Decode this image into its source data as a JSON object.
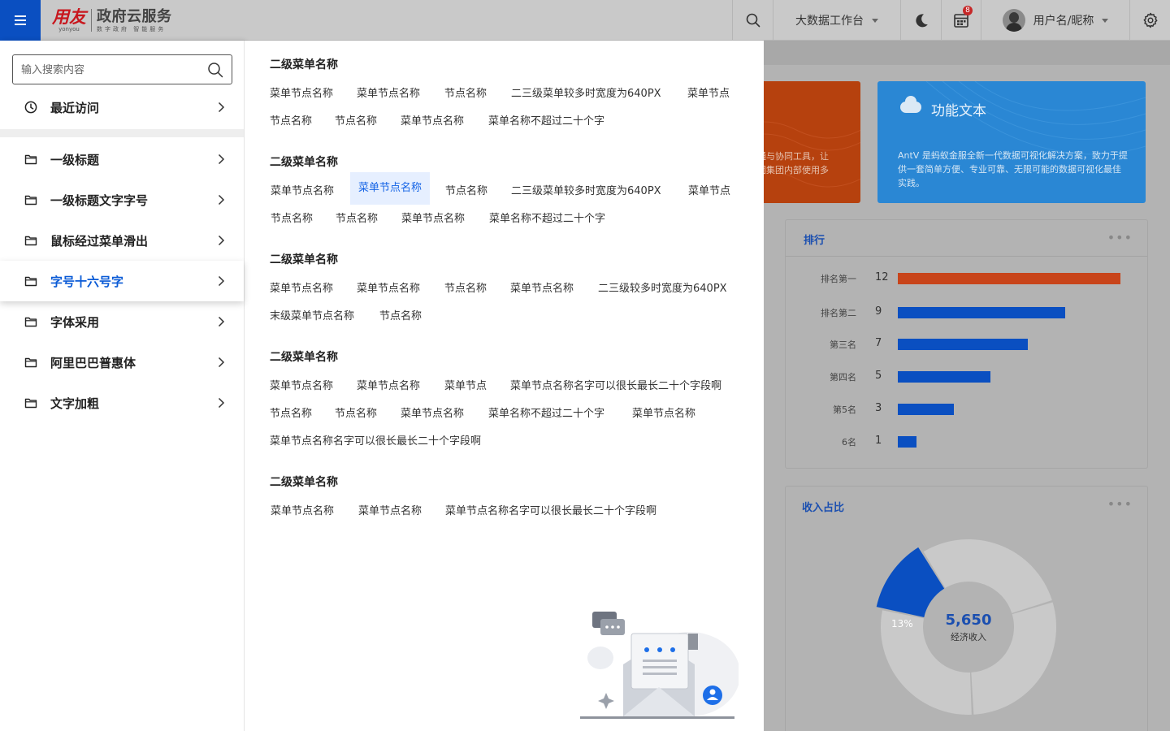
{
  "header": {
    "menu_icon": "hamburger-icon",
    "logo": {
      "brand": "用友",
      "brand_sub": "yonyou",
      "product": "政府云服务",
      "slogan": "数字政府 智能服务"
    },
    "workbench_label": "大数据工作台",
    "notification_count": "8",
    "username": "用户名/昵称",
    "icons": {
      "search": "search-icon",
      "theme": "moon-icon",
      "notice": "calendar-icon",
      "settings": "gear-icon"
    }
  },
  "sidebar": {
    "search_placeholder": "输入搜索内容",
    "recent_label": "最近访问",
    "items": [
      {
        "label": "一级标题"
      },
      {
        "label": "一级标题文字字号"
      },
      {
        "label": "鼠标经过菜单滑出"
      },
      {
        "label": "字号十六号字",
        "active": true
      },
      {
        "label": "字体采用"
      },
      {
        "label": "阿里巴巴普惠体"
      },
      {
        "label": "文字加粗"
      }
    ]
  },
  "flyout": {
    "groups": [
      {
        "title": "二级菜单名称",
        "rows": [
          [
            "菜单节点名称",
            "菜单节点名称",
            "节点名称",
            "二三级菜单较多时宽度为640PX",
            "菜单节点"
          ],
          [
            "节点名称",
            "节点名称",
            "菜单节点名称",
            "菜单名称不超过二十个字"
          ]
        ]
      },
      {
        "title": "二级菜单名称",
        "rows": [
          [
            "菜单节点名称",
            "菜单节点名称",
            "节点名称",
            "二三级菜单较多时宽度为640PX",
            "菜单节点"
          ],
          [
            "节点名称",
            "节点名称",
            "菜单节点名称",
            "菜单名称不超过二十个字"
          ]
        ]
      },
      {
        "title": "二级菜单名称",
        "rows": [
          [
            "菜单节点名称",
            "菜单节点名称",
            "节点名称",
            "菜单节点名称",
            "二三级较多时宽度为640PX"
          ],
          [
            "末级菜单节点名称",
            "节点名称"
          ]
        ]
      },
      {
        "title": "二级菜单名称",
        "rows": [
          [
            "菜单节点名称",
            "菜单节点名称",
            "菜单节点",
            "菜单节点名称名字可以很长最长二十个字段啊"
          ],
          [
            "节点名称",
            "节点名称",
            "菜单节点名称",
            "菜单名称不超过二十个字",
            "菜单节点名称"
          ],
          [
            "菜单节点名称名字可以很长最长二十个字段啊"
          ]
        ]
      },
      {
        "title": "二级菜单名称",
        "rows": [
          [
            "菜单节点名称",
            "菜单节点名称",
            "菜单节点名称名字可以很长最长二十个字段啊"
          ]
        ]
      }
    ]
  },
  "dashboard": {
    "card_orange_text": [
      "通与协同工具，让",
      "团集团内部使用多"
    ],
    "card_blue": {
      "title": "功能文本",
      "icon": "cloud-icon",
      "desc": "AntV 是蚂蚁金服全新一代数据可视化解决方案，致力于提供一套简单方便、专业可靠、无限可能的数据可视化最佳实践。"
    },
    "rank_panel_title": "排行",
    "income_panel_title": "收入占比"
  },
  "chart_data": [
    {
      "type": "bar",
      "orientation": "horizontal",
      "title": "排行",
      "categories": [
        "排名第一",
        "排名第二",
        "第三名",
        "第四名",
        "第5名",
        "6名"
      ],
      "values": [
        12,
        9,
        7,
        5,
        3,
        1
      ],
      "colors": [
        "#c8441a",
        "#0a4fc1",
        "#0a4fc1",
        "#0a4fc1",
        "#0a4fc1",
        "#0a4fc1"
      ],
      "xlim": [
        0,
        12
      ]
    },
    {
      "type": "pie",
      "title": "收入占比",
      "center_value": "5,650",
      "center_label": "经济收入",
      "slices": [
        {
          "label": "13%",
          "value": 13,
          "color": "#0a4fc1"
        },
        {
          "value": 29,
          "color": "#c9c9c9"
        },
        {
          "value": 29,
          "color": "#c9c9c9"
        },
        {
          "value": 29,
          "color": "#c9c9c9"
        }
      ]
    }
  ]
}
